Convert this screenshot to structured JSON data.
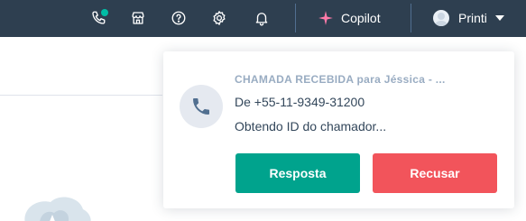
{
  "colors": {
    "topbar_bg": "#2e3f50",
    "notification_dot": "#00bda5",
    "answer_button": "#00a38d",
    "decline_button": "#f2545b",
    "copilot_accent": "#ff7aa8"
  },
  "topbar": {
    "icons": [
      "phone-icon",
      "marketplace-icon",
      "help-icon",
      "settings-icon",
      "notifications-icon"
    ],
    "copilot_label": "Copilot",
    "account_label": "Printi"
  },
  "call_card": {
    "title": "CHAMADA RECEBIDA para Jéssica - ...",
    "number_line": "De +55-11-9349-31200",
    "status_line": "Obtendo ID do chamador...",
    "answer_label": "Resposta",
    "decline_label": "Recusar"
  }
}
